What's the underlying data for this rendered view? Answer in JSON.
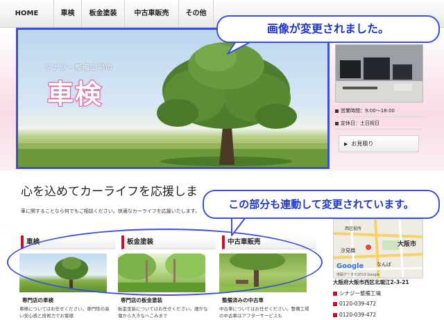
{
  "nav": {
    "items": [
      "HOME",
      "車検",
      "板金塗装",
      "中古車販売",
      "その他"
    ]
  },
  "hero": {
    "subtitle": "シナジー整備工場の",
    "title": "車検"
  },
  "sidebar": {
    "hours_label": "営業時間：",
    "hours_value": "9:00〜18:00",
    "closed_label": "定休日：",
    "closed_value": "土日祝日",
    "estimate_button": "お見積り",
    "map": {
      "labels": [
        "西区役所",
        "汐見橋",
        "大阪市",
        "なんば",
        "Google",
        "地図データ©2013 Google"
      ]
    },
    "address": "大阪府大阪市西区北堀江2-3-21",
    "company": "シナジー整備工場",
    "phone1": "0120-039-472",
    "phone2": "0120-039-472"
  },
  "main": {
    "tagline": "心を込めてカーライフを応援しま",
    "intro": "車に関することなら何でもご相談ください。快適なカーライフを応援いたします。",
    "cards": [
      {
        "title": "車検",
        "caption": "専門店の車検",
        "text": "車検についてはお任せください。専門性の高い安心感と技術力でお客様"
      },
      {
        "title": "板金塗装",
        "caption": "専門店の板金塗装",
        "text": "板金塗装についてはお任せください。細かな傷から大きなへこみまで"
      },
      {
        "title": "中古車販売",
        "caption": "整備済みの中古車",
        "text": "中古車についてはお任せください。整備工場の中古車はアフターサービスも"
      }
    ]
  },
  "callouts": {
    "top": "画像が変更されました。",
    "middle": "この部分も連動して変更されています。"
  },
  "colors": {
    "annotation_blue": "#3a4fd6",
    "accent_red": "#c8102e",
    "title_pink": "#e8579a"
  }
}
